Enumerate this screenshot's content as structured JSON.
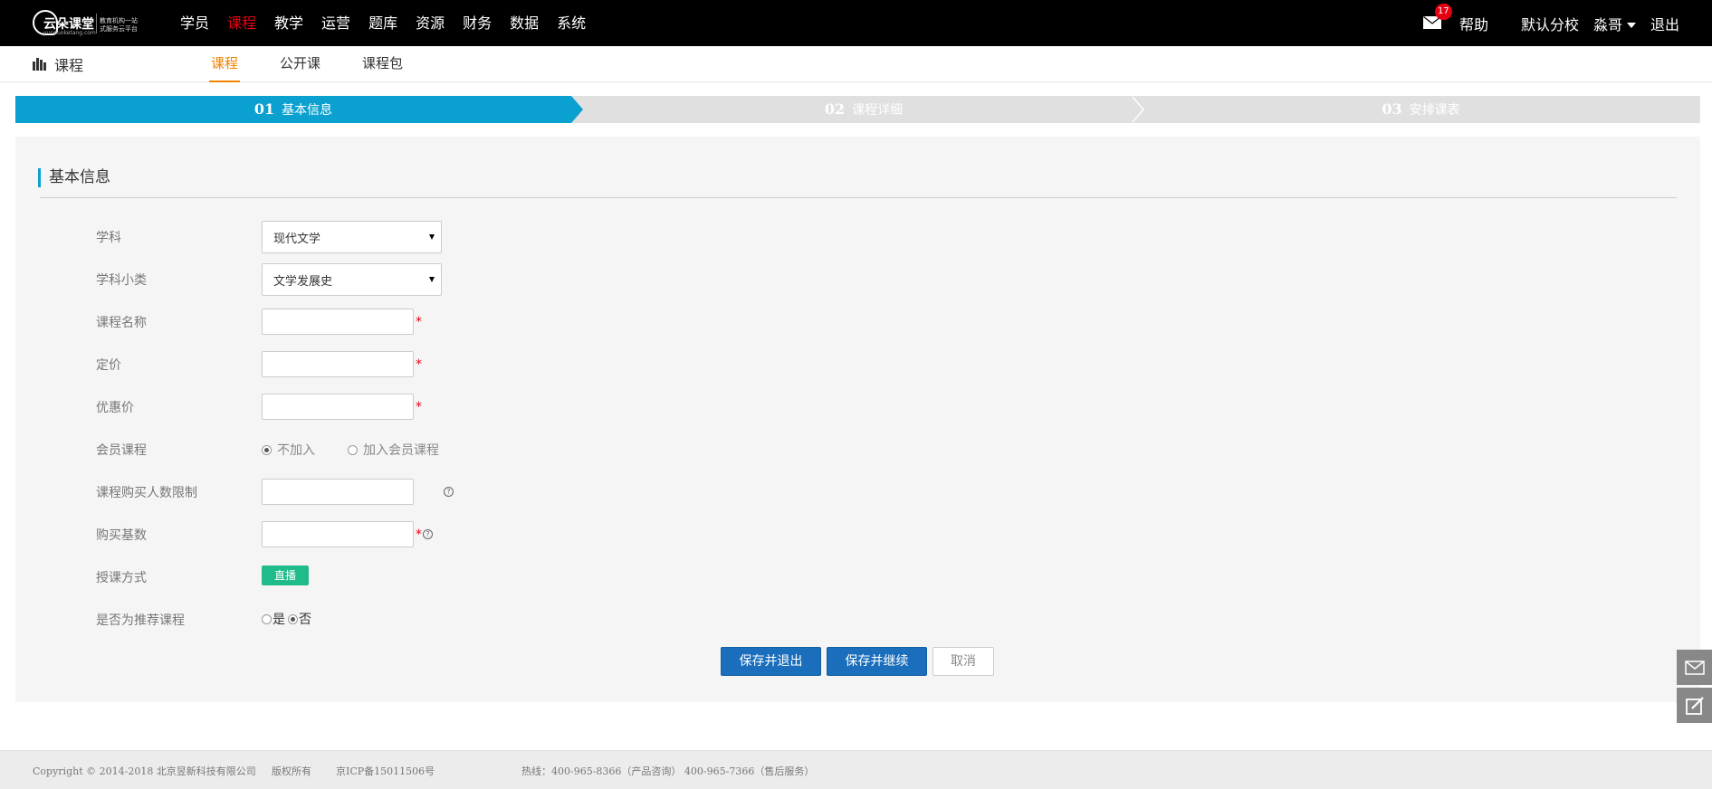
{
  "header": {
    "logo": {
      "brand": "云朵课堂",
      "tagline1": "教育机构一站",
      "tagline2": "式服务云平台",
      "url": "yunduoketang.com"
    },
    "nav": [
      {
        "label": "学员",
        "active": false
      },
      {
        "label": "课程",
        "active": true
      },
      {
        "label": "教学",
        "active": false
      },
      {
        "label": "运营",
        "active": false
      },
      {
        "label": "题库",
        "active": false
      },
      {
        "label": "资源",
        "active": false
      },
      {
        "label": "财务",
        "active": false
      },
      {
        "label": "数据",
        "active": false
      },
      {
        "label": "系统",
        "active": false
      }
    ],
    "mail_count": "17",
    "help": "帮助",
    "branch": "默认分校",
    "user": "淼哥",
    "logout": "退出"
  },
  "subheader": {
    "title": "课程",
    "tabs": [
      {
        "label": "课程",
        "active": true
      },
      {
        "label": "公开课",
        "active": false
      },
      {
        "label": "课程包",
        "active": false
      }
    ]
  },
  "steps": [
    {
      "num": "01",
      "label": "基本信息",
      "active": true
    },
    {
      "num": "02",
      "label": "课程详细",
      "active": false
    },
    {
      "num": "03",
      "label": "安排课表",
      "active": false
    }
  ],
  "form": {
    "section_title": "基本信息",
    "subject": {
      "label": "学科",
      "value": "现代文学"
    },
    "subcategory": {
      "label": "学科小类",
      "value": "文学发展史"
    },
    "course_name": {
      "label": "课程名称",
      "value": ""
    },
    "price": {
      "label": "定价",
      "value": ""
    },
    "discount_price": {
      "label": "优惠价",
      "value": ""
    },
    "member": {
      "label": "会员课程",
      "option_no": "不加入",
      "option_yes": "加入会员课程",
      "selected": "no"
    },
    "limit": {
      "label": "课程购买人数限制",
      "value": ""
    },
    "base": {
      "label": "购买基数",
      "value": ""
    },
    "mode": {
      "label": "授课方式",
      "value": "直播"
    },
    "recommend": {
      "label": "是否为推荐课程",
      "option_yes": "是",
      "option_no": "否",
      "selected": "no"
    },
    "required_mark": "*",
    "help_mark": "?",
    "buttons": {
      "save_exit": "保存并退出",
      "save_continue": "保存并继续",
      "cancel": "取消"
    }
  },
  "footer": {
    "copyright": "Copyright © 2014-2018 北京昱新科技有限公司",
    "rights": "版权所有",
    "icp": "京ICP备15011506号",
    "hotline": "热线：400-965-8366（产品咨询） 400-965-7366（售后服务）"
  },
  "colors": {
    "accent": "#0aa0cf",
    "active_nav": "#e60012",
    "active_tab": "#f08300",
    "primary_button": "#1a6ebc",
    "live_tag": "#1fbb8a"
  }
}
